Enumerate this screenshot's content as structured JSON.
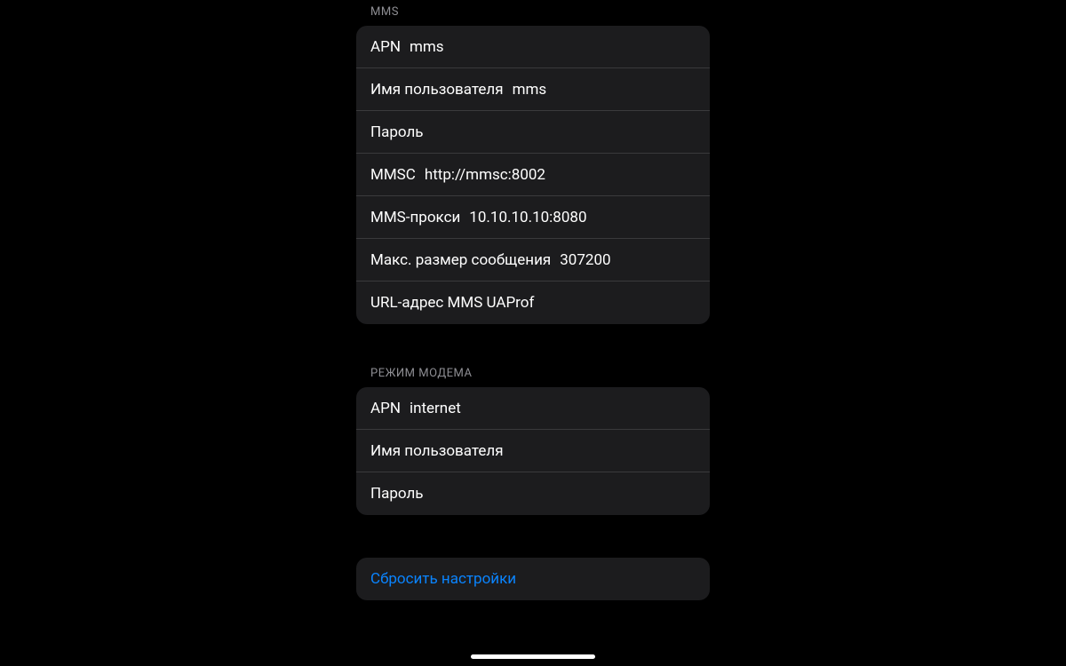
{
  "mms": {
    "header": "MMS",
    "rows": [
      {
        "label": "APN",
        "value": "mms"
      },
      {
        "label": "Имя пользователя",
        "value": "mms"
      },
      {
        "label": "Пароль",
        "value": ""
      },
      {
        "label": "MMSC",
        "value": "http://mmsc:8002"
      },
      {
        "label": "MMS-прокси",
        "value": "10.10.10.10:8080"
      },
      {
        "label": "Макс. размер сообщения",
        "value": "307200"
      },
      {
        "label": "URL-адрес MMS UAProf",
        "value": ""
      }
    ]
  },
  "tethering": {
    "header": "РЕЖИМ МОДЕМА",
    "rows": [
      {
        "label": "APN",
        "value": "internet"
      },
      {
        "label": "Имя пользователя",
        "value": ""
      },
      {
        "label": "Пароль",
        "value": ""
      }
    ]
  },
  "reset": {
    "label": "Сбросить настройки"
  }
}
